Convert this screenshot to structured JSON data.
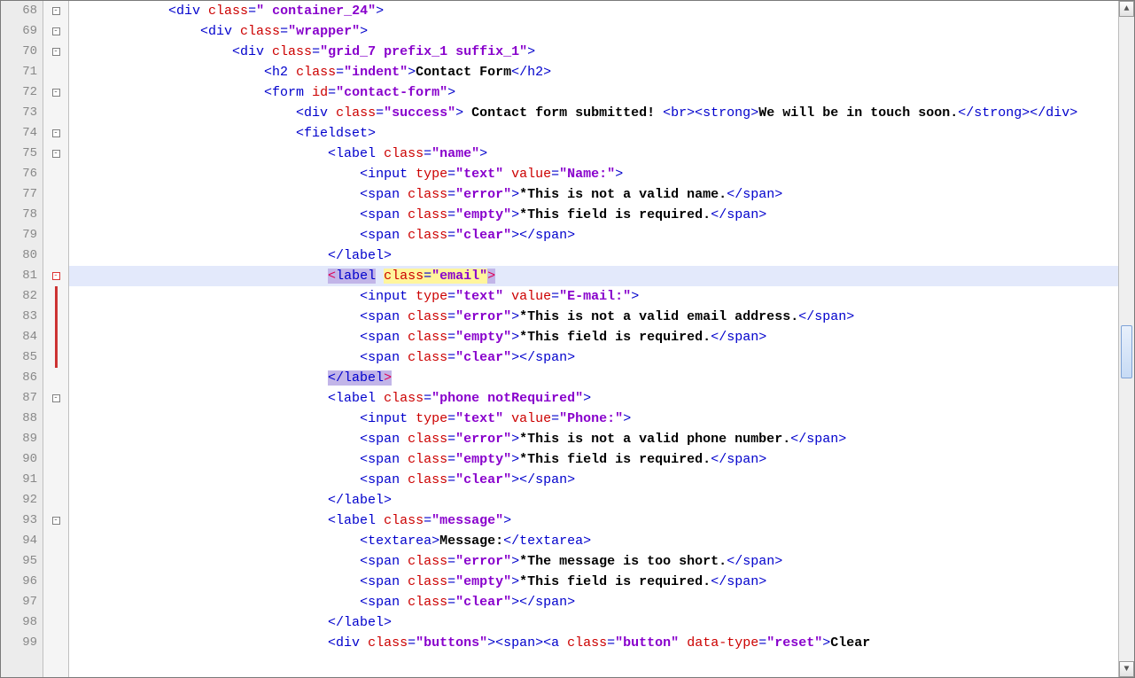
{
  "lines": [
    {
      "n": 68,
      "fold": "minus",
      "indent": 3,
      "tokens": [
        {
          "t": "tag",
          "s": "<div "
        },
        {
          "t": "attr",
          "s": "class"
        },
        {
          "t": "tag",
          "s": "="
        },
        {
          "t": "val",
          "s": "\" container_24\""
        },
        {
          "t": "gt",
          "s": ">"
        }
      ]
    },
    {
      "n": 69,
      "fold": "minus",
      "indent": 4,
      "tokens": [
        {
          "t": "tag",
          "s": "<div "
        },
        {
          "t": "attr",
          "s": "class"
        },
        {
          "t": "tag",
          "s": "="
        },
        {
          "t": "val",
          "s": "\"wrapper\""
        },
        {
          "t": "gt",
          "s": ">"
        }
      ]
    },
    {
      "n": 70,
      "fold": "minus",
      "indent": 5,
      "tokens": [
        {
          "t": "tag",
          "s": "<div "
        },
        {
          "t": "attr",
          "s": "class"
        },
        {
          "t": "tag",
          "s": "="
        },
        {
          "t": "val",
          "s": "\"grid_7 prefix_1 suffix_1\""
        },
        {
          "t": "gt",
          "s": ">"
        }
      ]
    },
    {
      "n": 71,
      "fold": "",
      "indent": 6,
      "tokens": [
        {
          "t": "tag",
          "s": "<h2 "
        },
        {
          "t": "attr",
          "s": "class"
        },
        {
          "t": "tag",
          "s": "="
        },
        {
          "t": "val",
          "s": "\"indent\""
        },
        {
          "t": "gt",
          "s": ">"
        },
        {
          "t": "txt",
          "s": "Contact Form"
        },
        {
          "t": "tag",
          "s": "</h2>"
        }
      ]
    },
    {
      "n": 72,
      "fold": "minus",
      "indent": 6,
      "tokens": [
        {
          "t": "tag",
          "s": "<form "
        },
        {
          "t": "attr",
          "s": "id"
        },
        {
          "t": "tag",
          "s": "="
        },
        {
          "t": "val",
          "s": "\"contact-form\""
        },
        {
          "t": "gt",
          "s": ">"
        }
      ]
    },
    {
      "n": 73,
      "fold": "",
      "indent": 7,
      "tokens": [
        {
          "t": "tag",
          "s": "<div "
        },
        {
          "t": "attr",
          "s": "class"
        },
        {
          "t": "tag",
          "s": "="
        },
        {
          "t": "val",
          "s": "\"success\""
        },
        {
          "t": "gt",
          "s": "> "
        },
        {
          "t": "txt",
          "s": "Contact form submitted! "
        },
        {
          "t": "tag",
          "s": "<br><strong>"
        },
        {
          "t": "txt",
          "s": "We will be in touch soon."
        },
        {
          "t": "tag",
          "s": "</strong></div>"
        }
      ]
    },
    {
      "n": 74,
      "fold": "minus",
      "indent": 7,
      "tokens": [
        {
          "t": "tag",
          "s": "<fieldset>"
        }
      ]
    },
    {
      "n": 75,
      "fold": "minus",
      "indent": 8,
      "tokens": [
        {
          "t": "tag",
          "s": "<label "
        },
        {
          "t": "attr",
          "s": "class"
        },
        {
          "t": "tag",
          "s": "="
        },
        {
          "t": "val",
          "s": "\"name\""
        },
        {
          "t": "gt",
          "s": ">"
        }
      ]
    },
    {
      "n": 76,
      "fold": "",
      "indent": 9,
      "tokens": [
        {
          "t": "tag",
          "s": "<input "
        },
        {
          "t": "attr",
          "s": "type"
        },
        {
          "t": "tag",
          "s": "="
        },
        {
          "t": "val",
          "s": "\"text\""
        },
        {
          "t": "tag",
          "s": " "
        },
        {
          "t": "attr",
          "s": "value"
        },
        {
          "t": "tag",
          "s": "="
        },
        {
          "t": "val",
          "s": "\"Name:\""
        },
        {
          "t": "gt",
          "s": ">"
        }
      ]
    },
    {
      "n": 77,
      "fold": "",
      "indent": 9,
      "tokens": [
        {
          "t": "tag",
          "s": "<span "
        },
        {
          "t": "attr",
          "s": "class"
        },
        {
          "t": "tag",
          "s": "="
        },
        {
          "t": "val",
          "s": "\"error\""
        },
        {
          "t": "gt",
          "s": ">"
        },
        {
          "t": "txt",
          "s": "*This is not a valid name."
        },
        {
          "t": "tag",
          "s": "</span>"
        }
      ]
    },
    {
      "n": 78,
      "fold": "",
      "indent": 9,
      "tokens": [
        {
          "t": "tag",
          "s": "<span "
        },
        {
          "t": "attr",
          "s": "class"
        },
        {
          "t": "tag",
          "s": "="
        },
        {
          "t": "val",
          "s": "\"empty\""
        },
        {
          "t": "gt",
          "s": ">"
        },
        {
          "t": "txt",
          "s": "*This field is required."
        },
        {
          "t": "tag",
          "s": "</span>"
        }
      ]
    },
    {
      "n": 79,
      "fold": "",
      "indent": 9,
      "tokens": [
        {
          "t": "tag",
          "s": "<span "
        },
        {
          "t": "attr",
          "s": "class"
        },
        {
          "t": "tag",
          "s": "="
        },
        {
          "t": "val",
          "s": "\"clear\""
        },
        {
          "t": "gt",
          "s": ">"
        },
        {
          "t": "tag",
          "s": "</span>"
        }
      ]
    },
    {
      "n": 80,
      "fold": "",
      "indent": 8,
      "tokens": [
        {
          "t": "tag",
          "s": "</label>"
        }
      ]
    },
    {
      "n": 81,
      "fold": "minus-red",
      "hl": true,
      "indent": 8,
      "tokens": [
        {
          "t": "seltag",
          "cls": "selmark2",
          "s": "<"
        },
        {
          "t": "tag",
          "cls": "selmark2",
          "s": "label"
        },
        {
          "t": "plain",
          "s": " "
        },
        {
          "t": "attr",
          "cls": "selmark1",
          "s": "class"
        },
        {
          "t": "tag",
          "cls": "selmark1",
          "s": "="
        },
        {
          "t": "val",
          "cls": "selmark1",
          "s": "\"email\""
        },
        {
          "t": "seltag",
          "cls": "selmark2",
          "s": ">"
        }
      ]
    },
    {
      "n": 82,
      "fold": "",
      "redbar": true,
      "indent": 9,
      "tokens": [
        {
          "t": "tag",
          "s": "<input "
        },
        {
          "t": "attr",
          "s": "type"
        },
        {
          "t": "tag",
          "s": "="
        },
        {
          "t": "val",
          "s": "\"text\""
        },
        {
          "t": "tag",
          "s": " "
        },
        {
          "t": "attr",
          "s": "value"
        },
        {
          "t": "tag",
          "s": "="
        },
        {
          "t": "val",
          "s": "\"E-mail:\""
        },
        {
          "t": "gt",
          "s": ">"
        }
      ]
    },
    {
      "n": 83,
      "fold": "",
      "redbar": true,
      "indent": 9,
      "tokens": [
        {
          "t": "tag",
          "s": "<span "
        },
        {
          "t": "attr",
          "s": "class"
        },
        {
          "t": "tag",
          "s": "="
        },
        {
          "t": "val",
          "s": "\"error\""
        },
        {
          "t": "gt",
          "s": ">"
        },
        {
          "t": "txt",
          "s": "*This is not a valid email address."
        },
        {
          "t": "tag",
          "s": "</span>"
        }
      ]
    },
    {
      "n": 84,
      "fold": "",
      "redbar": true,
      "indent": 9,
      "tokens": [
        {
          "t": "tag",
          "s": "<span "
        },
        {
          "t": "attr",
          "s": "class"
        },
        {
          "t": "tag",
          "s": "="
        },
        {
          "t": "val",
          "s": "\"empty\""
        },
        {
          "t": "gt",
          "s": ">"
        },
        {
          "t": "txt",
          "s": "*This field is required."
        },
        {
          "t": "tag",
          "s": "</span>"
        }
      ]
    },
    {
      "n": 85,
      "fold": "",
      "redbar": true,
      "indent": 9,
      "tokens": [
        {
          "t": "tag",
          "s": "<span "
        },
        {
          "t": "attr",
          "s": "class"
        },
        {
          "t": "tag",
          "s": "="
        },
        {
          "t": "val",
          "s": "\"clear\""
        },
        {
          "t": "gt",
          "s": ">"
        },
        {
          "t": "tag",
          "s": "</span>"
        }
      ]
    },
    {
      "n": 86,
      "fold": "",
      "indent": 8,
      "tokens": [
        {
          "t": "tag",
          "cls": "selmark2",
          "s": "</label"
        },
        {
          "t": "seltag",
          "cls": "selmark2",
          "s": ">"
        }
      ]
    },
    {
      "n": 87,
      "fold": "minus",
      "indent": 8,
      "tokens": [
        {
          "t": "tag",
          "s": "<label "
        },
        {
          "t": "attr",
          "s": "class"
        },
        {
          "t": "tag",
          "s": "="
        },
        {
          "t": "val",
          "s": "\"phone notRequired\""
        },
        {
          "t": "gt",
          "s": ">"
        }
      ]
    },
    {
      "n": 88,
      "fold": "",
      "indent": 9,
      "tokens": [
        {
          "t": "tag",
          "s": "<input "
        },
        {
          "t": "attr",
          "s": "type"
        },
        {
          "t": "tag",
          "s": "="
        },
        {
          "t": "val",
          "s": "\"text\""
        },
        {
          "t": "tag",
          "s": " "
        },
        {
          "t": "attr",
          "s": "value"
        },
        {
          "t": "tag",
          "s": "="
        },
        {
          "t": "val",
          "s": "\"Phone:\""
        },
        {
          "t": "gt",
          "s": ">"
        }
      ]
    },
    {
      "n": 89,
      "fold": "",
      "indent": 9,
      "tokens": [
        {
          "t": "tag",
          "s": "<span "
        },
        {
          "t": "attr",
          "s": "class"
        },
        {
          "t": "tag",
          "s": "="
        },
        {
          "t": "val",
          "s": "\"error\""
        },
        {
          "t": "gt",
          "s": ">"
        },
        {
          "t": "txt",
          "s": "*This is not a valid phone number."
        },
        {
          "t": "tag",
          "s": "</span>"
        }
      ]
    },
    {
      "n": 90,
      "fold": "",
      "indent": 9,
      "tokens": [
        {
          "t": "tag",
          "s": "<span "
        },
        {
          "t": "attr",
          "s": "class"
        },
        {
          "t": "tag",
          "s": "="
        },
        {
          "t": "val",
          "s": "\"empty\""
        },
        {
          "t": "gt",
          "s": ">"
        },
        {
          "t": "txt",
          "s": "*This field is required."
        },
        {
          "t": "tag",
          "s": "</span>"
        }
      ]
    },
    {
      "n": 91,
      "fold": "",
      "indent": 9,
      "tokens": [
        {
          "t": "tag",
          "s": "<span "
        },
        {
          "t": "attr",
          "s": "class"
        },
        {
          "t": "tag",
          "s": "="
        },
        {
          "t": "val",
          "s": "\"clear\""
        },
        {
          "t": "gt",
          "s": ">"
        },
        {
          "t": "tag",
          "s": "</span>"
        }
      ]
    },
    {
      "n": 92,
      "fold": "",
      "indent": 8,
      "tokens": [
        {
          "t": "tag",
          "s": "</label>"
        }
      ]
    },
    {
      "n": 93,
      "fold": "minus",
      "indent": 8,
      "tokens": [
        {
          "t": "tag",
          "s": "<label "
        },
        {
          "t": "attr",
          "s": "class"
        },
        {
          "t": "tag",
          "s": "="
        },
        {
          "t": "val",
          "s": "\"message\""
        },
        {
          "t": "gt",
          "s": ">"
        }
      ]
    },
    {
      "n": 94,
      "fold": "",
      "indent": 9,
      "tokens": [
        {
          "t": "tag",
          "s": "<textarea>"
        },
        {
          "t": "txt",
          "s": "Message:"
        },
        {
          "t": "tag",
          "s": "</textarea>"
        }
      ]
    },
    {
      "n": 95,
      "fold": "",
      "indent": 9,
      "tokens": [
        {
          "t": "tag",
          "s": "<span "
        },
        {
          "t": "attr",
          "s": "class"
        },
        {
          "t": "tag",
          "s": "="
        },
        {
          "t": "val",
          "s": "\"error\""
        },
        {
          "t": "gt",
          "s": ">"
        },
        {
          "t": "txt",
          "s": "*The message is too short."
        },
        {
          "t": "tag",
          "s": "</span>"
        }
      ]
    },
    {
      "n": 96,
      "fold": "",
      "indent": 9,
      "tokens": [
        {
          "t": "tag",
          "s": "<span "
        },
        {
          "t": "attr",
          "s": "class"
        },
        {
          "t": "tag",
          "s": "="
        },
        {
          "t": "val",
          "s": "\"empty\""
        },
        {
          "t": "gt",
          "s": ">"
        },
        {
          "t": "txt",
          "s": "*This field is required."
        },
        {
          "t": "tag",
          "s": "</span>"
        }
      ]
    },
    {
      "n": 97,
      "fold": "",
      "indent": 9,
      "tokens": [
        {
          "t": "tag",
          "s": "<span "
        },
        {
          "t": "attr",
          "s": "class"
        },
        {
          "t": "tag",
          "s": "="
        },
        {
          "t": "val",
          "s": "\"clear\""
        },
        {
          "t": "gt",
          "s": ">"
        },
        {
          "t": "tag",
          "s": "</span>"
        }
      ]
    },
    {
      "n": 98,
      "fold": "",
      "indent": 8,
      "tokens": [
        {
          "t": "tag",
          "s": "</label>"
        }
      ]
    },
    {
      "n": 99,
      "fold": "",
      "indent": 8,
      "tokens": [
        {
          "t": "tag",
          "s": "<div "
        },
        {
          "t": "attr",
          "s": "class"
        },
        {
          "t": "tag",
          "s": "="
        },
        {
          "t": "val",
          "s": "\"buttons\""
        },
        {
          "t": "gt",
          "s": ">"
        },
        {
          "t": "tag",
          "s": "<span><a "
        },
        {
          "t": "attr",
          "s": "class"
        },
        {
          "t": "tag",
          "s": "="
        },
        {
          "t": "val",
          "s": "\"button\""
        },
        {
          "t": "tag",
          "s": " "
        },
        {
          "t": "attr",
          "s": "data-type"
        },
        {
          "t": "tag",
          "s": "="
        },
        {
          "t": "val",
          "s": "\"reset\""
        },
        {
          "t": "gt",
          "s": ">"
        },
        {
          "t": "txt",
          "s": "Clear"
        }
      ]
    }
  ]
}
